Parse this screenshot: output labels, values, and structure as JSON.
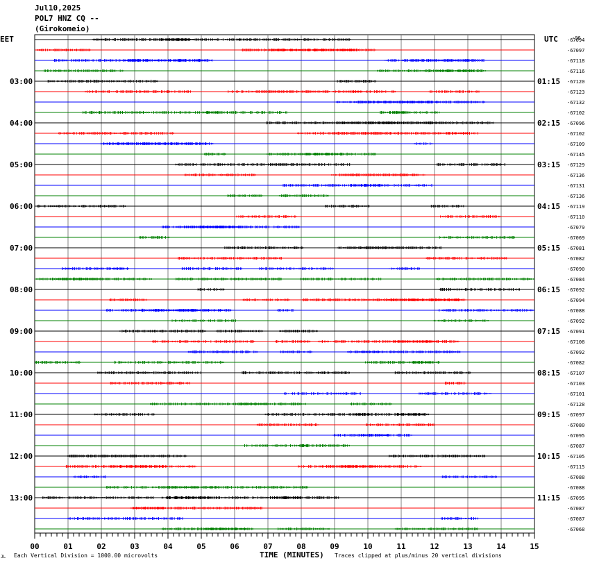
{
  "header": {
    "date": "Jul10,2025",
    "station": "POL7 HNZ CQ --",
    "location": "(Girokomeio)",
    "left_tz": "EET",
    "right_tz": "UTC",
    "corner_mark": "-96"
  },
  "footer": {
    "xlabel": "TIME (MINUTES)",
    "scale_note": "Each Vertical Division = 1000.00 microvolts",
    "clip_note": "Traces clipped at plus/minus 20 vertical divisions",
    "logo_mark": "JL"
  },
  "chart_data": {
    "type": "line",
    "title": "POL7 HNZ CQ -- (Girokomeio)",
    "xlabel": "TIME (MINUTES)",
    "ylabel": "",
    "xlim": [
      0,
      15
    ],
    "x_ticks": [
      "00",
      "01",
      "02",
      "03",
      "04",
      "05",
      "06",
      "07",
      "08",
      "09",
      "10",
      "11",
      "12",
      "13",
      "14",
      "15"
    ],
    "grid": true,
    "trace_colors": [
      "#000000",
      "#ff0000",
      "#0000ff",
      "#008000"
    ],
    "left_hour_labels": [
      "03:00",
      "04:00",
      "05:00",
      "06:00",
      "07:00",
      "08:00",
      "09:00",
      "10:00",
      "11:00",
      "12:00",
      "13:00"
    ],
    "right_hour_labels": [
      "01:15",
      "02:15",
      "03:15",
      "04:15",
      "05:15",
      "06:15",
      "07:15",
      "08:15",
      "09:15",
      "10:15",
      "11:15"
    ],
    "hour_label_first_trace": 4,
    "trace_offsets": [
      -67094,
      -67097,
      -67118,
      -67116,
      -67120,
      -67123,
      -67132,
      -67102,
      -67096,
      -67102,
      -67109,
      -67145,
      -67129,
      -67136,
      -67131,
      -67136,
      -67119,
      -67110,
      -67079,
      -67069,
      -67081,
      -67082,
      -67090,
      -67084,
      -67092,
      -67094,
      -67088,
      -67092,
      -67091,
      -67108,
      -67092,
      -67082,
      -67107,
      -67103,
      -67101,
      -67128,
      -67097,
      -67080,
      -67095,
      -67087,
      -67105,
      -67115,
      -67088,
      -67088,
      -67095,
      -67087,
      -67087,
      -67068
    ],
    "scale_microvolts_per_division": 1000.0,
    "clip_divisions": 20
  }
}
